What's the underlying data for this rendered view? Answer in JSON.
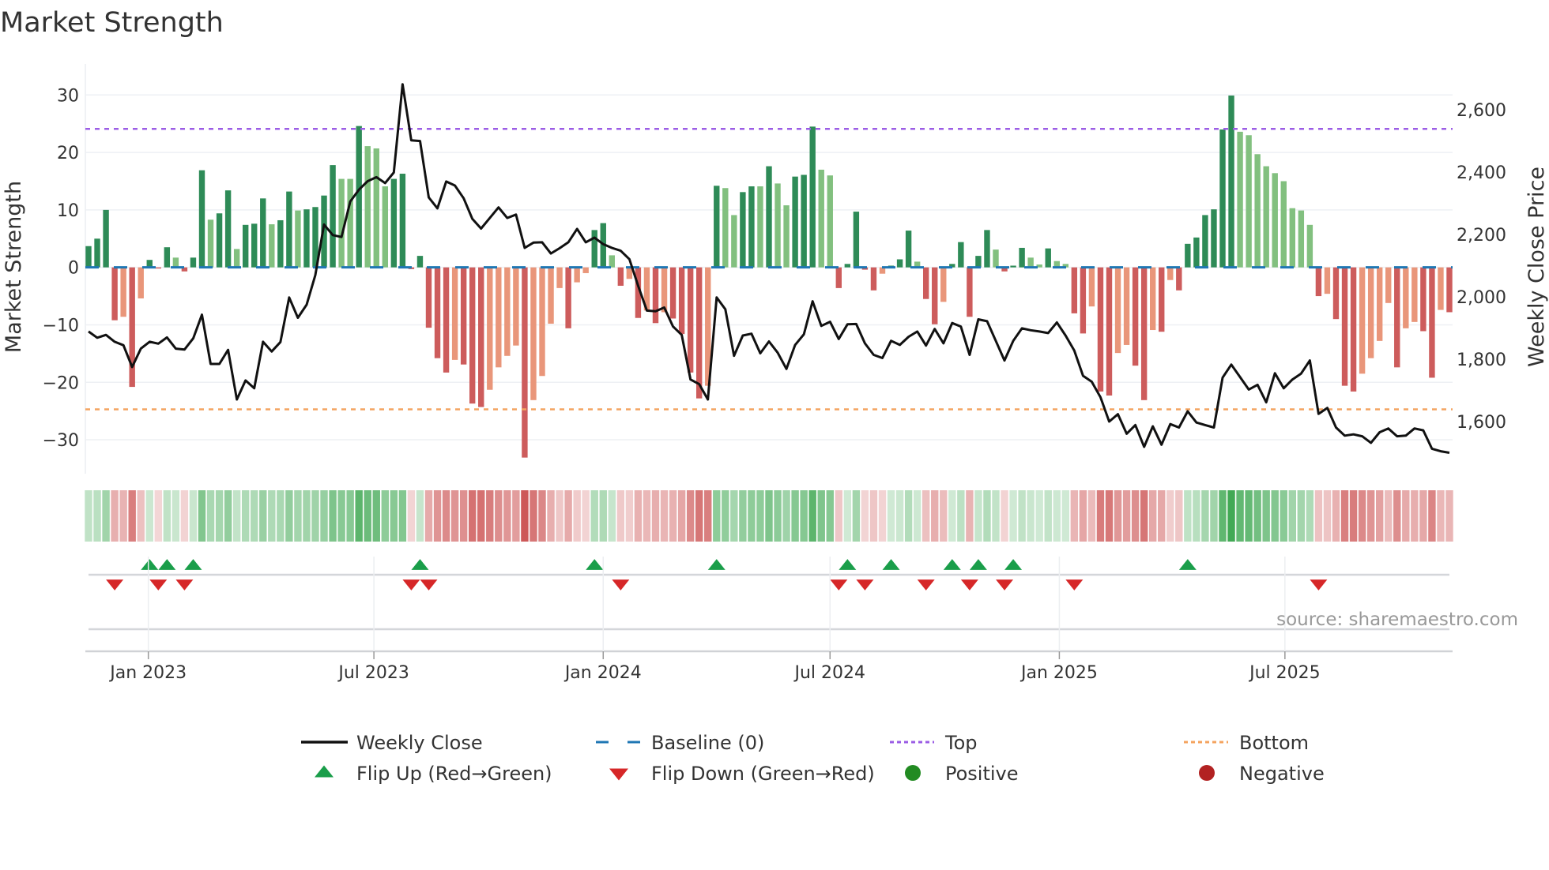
{
  "chart_data": {
    "type": "bar",
    "title": "Market Strength",
    "ylabel": "Market Strength",
    "y2label": "Weekly Close Price",
    "ylim": [
      -35.9,
      35.4
    ],
    "y2lim": [
      1433,
      2747
    ],
    "yticks": [
      -30,
      -20,
      -10,
      0,
      10,
      20,
      30
    ],
    "yticklabels": [
      "−30",
      "−20",
      "−10",
      "0",
      "10",
      "20",
      "30"
    ],
    "y2ticks": [
      1600,
      1800,
      2000,
      2200,
      2400,
      2600
    ],
    "y2ticklabels": [
      "1,600",
      "1,800",
      "2,000",
      "2,200",
      "2,400",
      "2,600"
    ],
    "x_start": "2022-11-14",
    "x_frequency": "weekly",
    "xticks": [
      {
        "date": "2023-01-01",
        "label": "Jan 2023"
      },
      {
        "date": "2023-07-01",
        "label": "Jul 2023"
      },
      {
        "date": "2024-01-01",
        "label": "Jan 2024"
      },
      {
        "date": "2024-07-01",
        "label": "Jul 2024"
      },
      {
        "date": "2025-01-01",
        "label": "Jan 2025"
      },
      {
        "date": "2025-07-01",
        "label": "Jul 2025"
      }
    ],
    "top_level": 24.1,
    "bottom_level": -24.7,
    "baseline": 0,
    "grid": true,
    "legend_position": "bottom",
    "series": [
      {
        "name": "Market Strength",
        "type": "bar",
        "values": [
          3.7,
          5.0,
          10.0,
          -9.2,
          -8.6,
          -20.8,
          -5.4,
          1.3,
          -0.2,
          3.5,
          1.7,
          -0.7,
          1.7,
          16.9,
          8.3,
          9.4,
          13.4,
          3.2,
          7.4,
          7.6,
          12.0,
          7.5,
          8.2,
          13.2,
          9.9,
          10.1,
          10.5,
          12.5,
          17.8,
          15.4,
          15.4,
          24.6,
          21.1,
          20.7,
          14.1,
          15.4,
          16.3,
          -0.3,
          2.0,
          -10.5,
          -15.8,
          -18.3,
          -16.1,
          -16.9,
          -23.7,
          -24.3,
          -21.3,
          -17.4,
          -15.4,
          -13.6,
          -33.1,
          -23.1,
          -18.9,
          -9.8,
          -3.6,
          -10.6,
          -2.6,
          -1.0,
          6.5,
          7.7,
          2.1,
          -3.2,
          -2.0,
          -8.8,
          -7.5,
          -9.7,
          -7.8,
          -8.9,
          -11.6,
          -18.3,
          -22.8,
          -20.6,
          14.2,
          13.8,
          9.1,
          13.1,
          14.1,
          14.1,
          17.6,
          14.6,
          10.8,
          15.8,
          16.1,
          24.5,
          17.0,
          16.0,
          -3.6,
          0.6,
          9.7,
          -0.4,
          -4.0,
          -1.1,
          0.3,
          1.4,
          6.4,
          1.0,
          -5.5,
          -9.9,
          -6.0,
          0.6,
          4.4,
          -8.6,
          2.0,
          6.5,
          3.1,
          -0.7,
          0.3,
          3.4,
          1.7,
          0.5,
          3.3,
          1.1,
          0.6,
          -8.0,
          -11.5,
          -6.8,
          -21.6,
          -22.3,
          -14.9,
          -13.5,
          -17.1,
          -23.1,
          -10.9,
          -11.2,
          -2.2,
          -4.0,
          4.1,
          5.2,
          9.1,
          10.1,
          24.0,
          29.9,
          23.6,
          23.0,
          19.7,
          17.6,
          16.4,
          15.0,
          10.3,
          9.9,
          7.4,
          -5.0,
          -4.6,
          -9.0,
          -20.6,
          -21.6,
          -18.5,
          -15.8,
          -12.8,
          -6.2,
          -17.4,
          -10.6,
          -9.5,
          -11.1,
          -19.2,
          -7.4,
          -7.8
        ]
      },
      {
        "name": "Weekly Close",
        "type": "line",
        "axis": "right",
        "values": [
          1889,
          1869,
          1878,
          1856,
          1845,
          1775,
          1834,
          1856,
          1850,
          1870,
          1834,
          1831,
          1867,
          1943,
          1785,
          1785,
          1830,
          1671,
          1732,
          1707,
          1856,
          1825,
          1855,
          1998,
          1933,
          1975,
          2070,
          2232,
          2198,
          2192,
          2306,
          2344,
          2371,
          2384,
          2365,
          2399,
          2682,
          2502,
          2500,
          2319,
          2284,
          2370,
          2357,
          2316,
          2250,
          2219,
          2253,
          2287,
          2253,
          2264,
          2157,
          2174,
          2175,
          2139,
          2156,
          2175,
          2218,
          2175,
          2190,
          2169,
          2157,
          2148,
          2121,
          2036,
          1956,
          1954,
          1966,
          1905,
          1878,
          1735,
          1720,
          1671,
          1998,
          1960,
          1811,
          1876,
          1882,
          1819,
          1857,
          1821,
          1769,
          1846,
          1880,
          1986,
          1907,
          1920,
          1865,
          1912,
          1913,
          1851,
          1814,
          1804,
          1859,
          1846,
          1872,
          1889,
          1844,
          1897,
          1851,
          1916,
          1905,
          1814,
          1928,
          1922,
          1859,
          1796,
          1859,
          1899,
          1893,
          1889,
          1884,
          1918,
          1876,
          1828,
          1747,
          1728,
          1678,
          1600,
          1624,
          1561,
          1589,
          1519,
          1585,
          1526,
          1592,
          1581,
          1633,
          1597,
          1589,
          1581,
          1741,
          1783,
          1743,
          1703,
          1718,
          1662,
          1755,
          1707,
          1735,
          1754,
          1796,
          1625,
          1644,
          1581,
          1555,
          1559,
          1553,
          1532,
          1566,
          1578,
          1553,
          1555,
          1578,
          1572,
          1513,
          1505,
          1500
        ]
      }
    ],
    "legend": [
      {
        "key": "close",
        "label": "Weekly Close"
      },
      {
        "key": "baseline",
        "label": "Baseline (0)"
      },
      {
        "key": "top",
        "label": "Top"
      },
      {
        "key": "bottom",
        "label": "Bottom"
      },
      {
        "key": "flip_up",
        "label": "Flip Up (Red→Green)"
      },
      {
        "key": "flip_down",
        "label": "Flip Down (Green→Red)"
      },
      {
        "key": "positive",
        "label": "Positive"
      },
      {
        "key": "negative",
        "label": "Negative"
      }
    ],
    "source": "source: sharemaestro.com"
  },
  "colors": {
    "pos_strong": "#2e8b57",
    "pos_weak": "#82c07f",
    "neg_strong": "#cd5c5c",
    "neg_weak": "#e9967a",
    "close": "#111111",
    "baseline": "#1f77b4",
    "top": "#9b5de5",
    "bottom": "#f4a460",
    "flip_up": "#1a9e4a",
    "flip_down": "#d62728",
    "positive": "#228b22",
    "negative": "#b22222"
  }
}
